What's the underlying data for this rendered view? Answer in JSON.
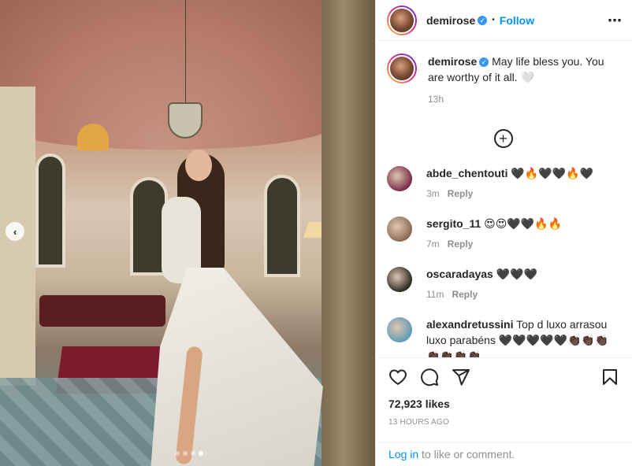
{
  "post": {
    "carousel": {
      "prev_icon": "chevron-left-icon",
      "prev_glyph": "‹",
      "slide_count": 4,
      "active_slide": 4
    },
    "author": {
      "username": "demirose",
      "verified_icon": "verified-badge-icon",
      "verified_glyph": "✓",
      "separator": "•",
      "follow_label": "Follow"
    },
    "more_glyph": "⋯",
    "caption": {
      "username": "demirose",
      "text": "May life bless you. You are worthy of it all. 🤍",
      "time": "13h"
    },
    "load_more_glyph": "+",
    "comments": [
      {
        "username": "abde_chentouti",
        "text": "🖤🔥🖤🖤🔥🖤",
        "time": "3m",
        "reply_label": "Reply",
        "avatar_color": "#7a2d4a"
      },
      {
        "username": "sergito_11",
        "text": "😍😍🖤🖤🔥🔥",
        "time": "7m",
        "reply_label": "Reply",
        "avatar_color": "#8a6c55"
      },
      {
        "username": "oscaradayas",
        "text": "🖤🖤🖤",
        "time": "11m",
        "reply_label": "Reply",
        "avatar_color": "#2d2b24"
      },
      {
        "username": "alexandretussini",
        "text": "Top d luxo arrasou luxo parabéns 🖤🖤🖤🖤🖤👏🏿👏🏿👏🏿👏🏿👏🏿👏🏿👏🏿",
        "time": "",
        "reply_label": "",
        "avatar_color": "#5e9bb5"
      }
    ],
    "likes": "72,923 likes",
    "posted_ago": "13 HOURS AGO",
    "login": {
      "link": "Log in",
      "rest": " to like or comment."
    },
    "colors": {
      "accent": "#0095f6",
      "text": "#262626",
      "muted": "#8e8e8e"
    }
  }
}
